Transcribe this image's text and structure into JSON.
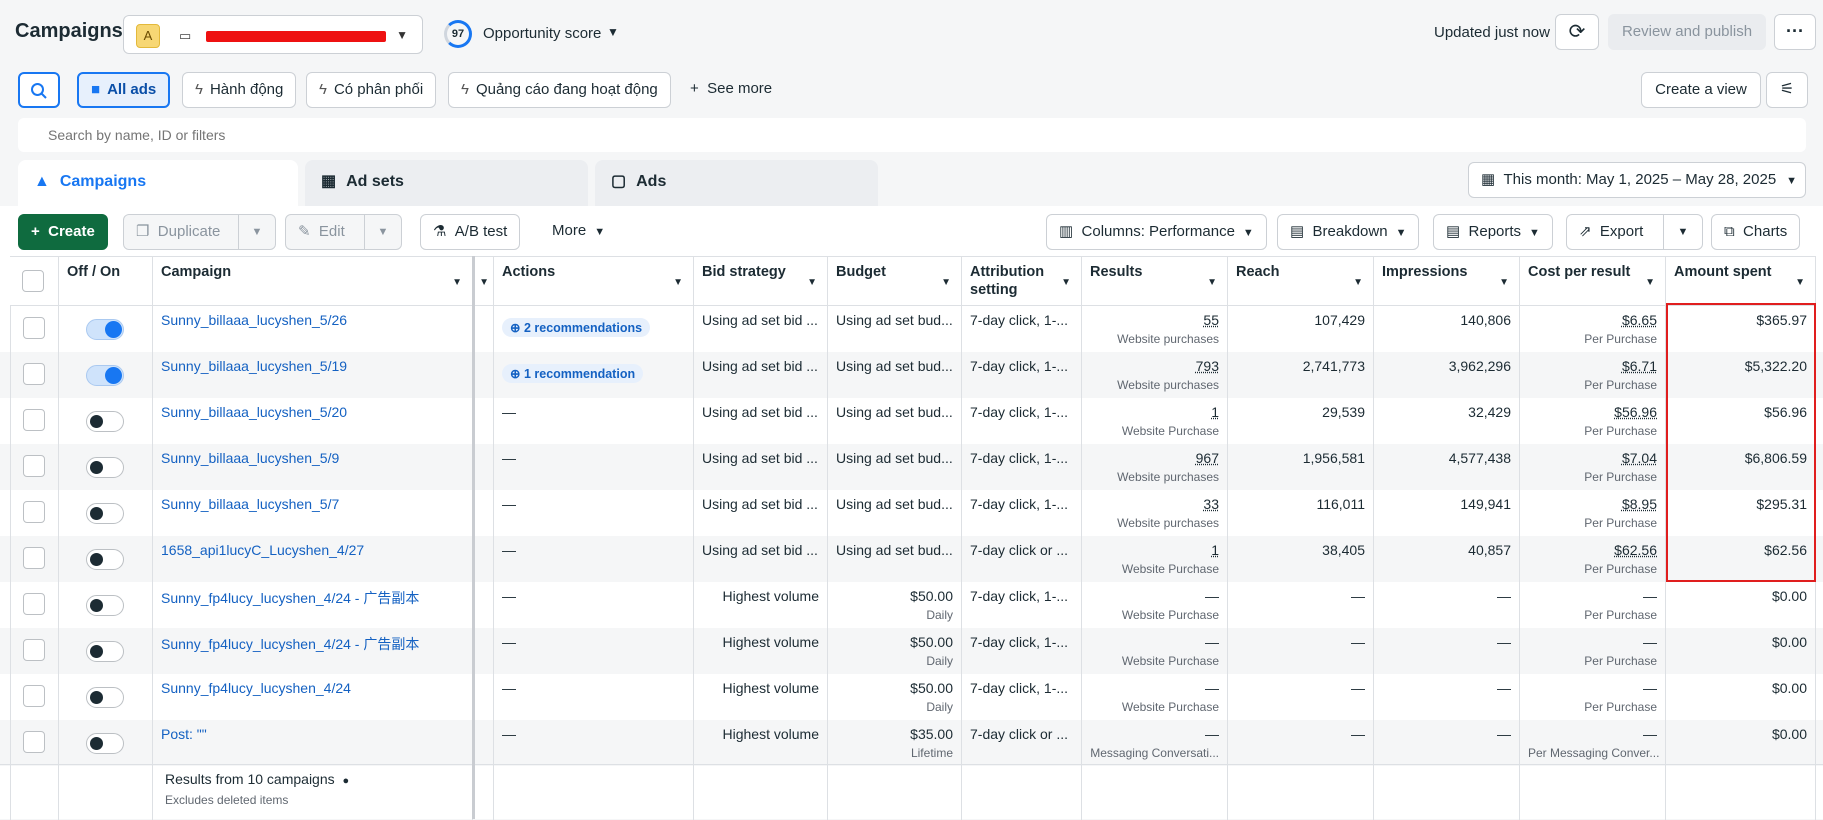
{
  "header": {
    "title": "Campaigns",
    "account_badge": "A",
    "opportunity_score": "97",
    "opportunity_label": "Opportunity score",
    "updated": "Updated just now",
    "review_publish": "Review and publish",
    "more": "···"
  },
  "filters": {
    "chips": [
      "All ads",
      "Hành động",
      "Có phân phối",
      "Quảng cáo đang hoạt động"
    ],
    "see_more": "See more",
    "create_view": "Create a view"
  },
  "search": {
    "placeholder": "Search by name, ID or filters"
  },
  "tabs": [
    "Campaigns",
    "Ad sets",
    "Ads"
  ],
  "date_range": "This month: May 1, 2025 – May 28, 2025",
  "toolbar": {
    "create": "Create",
    "duplicate": "Duplicate",
    "edit": "Edit",
    "ab_test": "A/B test",
    "more": "More",
    "columns": "Columns: Performance",
    "breakdown": "Breakdown",
    "reports": "Reports",
    "export": "Export",
    "charts": "Charts"
  },
  "columns": {
    "off_on": "Off / On",
    "campaign": "Campaign",
    "actions": "Actions",
    "bid": "Bid strategy",
    "budget": "Budget",
    "attribution": "Attribution setting",
    "results": "Results",
    "reach": "Reach",
    "impressions": "Impressions",
    "cpr": "Cost per result",
    "spent": "Amount spent"
  },
  "rows": [
    {
      "on": true,
      "campaign": "Sunny_billaaa_lucyshen_5/26",
      "actions": "2 recommendations",
      "bid": "Using ad set bid ...",
      "budget": "Using ad set bud...",
      "budget_sub": "",
      "attribution": "7-day click, 1-...",
      "results": "55",
      "results_sub": "Website purchases",
      "reach": "107,429",
      "impressions": "140,806",
      "cpr": "$6.65",
      "cpr_sub": "Per Purchase",
      "spent": "$365.97"
    },
    {
      "on": true,
      "campaign": "Sunny_billaaa_lucyshen_5/19",
      "actions": "1 recommendation",
      "bid": "Using ad set bid ...",
      "budget": "Using ad set bud...",
      "budget_sub": "",
      "attribution": "7-day click, 1-...",
      "results": "793",
      "results_sub": "Website purchases",
      "reach": "2,741,773",
      "impressions": "3,962,296",
      "cpr": "$6.71",
      "cpr_sub": "Per Purchase",
      "spent": "$5,322.20"
    },
    {
      "on": false,
      "campaign": "Sunny_billaaa_lucyshen_5/20",
      "actions": "—",
      "bid": "Using ad set bid ...",
      "budget": "Using ad set bud...",
      "budget_sub": "",
      "attribution": "7-day click, 1-...",
      "results": "1",
      "results_sub": "Website Purchase",
      "reach": "29,539",
      "impressions": "32,429",
      "cpr": "$56.96",
      "cpr_sub": "Per Purchase",
      "spent": "$56.96"
    },
    {
      "on": false,
      "campaign": "Sunny_billaaa_lucyshen_5/9",
      "actions": "—",
      "bid": "Using ad set bid ...",
      "budget": "Using ad set bud...",
      "budget_sub": "",
      "attribution": "7-day click, 1-...",
      "results": "967",
      "results_sub": "Website purchases",
      "reach": "1,956,581",
      "impressions": "4,577,438",
      "cpr": "$7.04",
      "cpr_sub": "Per Purchase",
      "spent": "$6,806.59"
    },
    {
      "on": false,
      "campaign": "Sunny_billaaa_lucyshen_5/7",
      "actions": "—",
      "bid": "Using ad set bid ...",
      "budget": "Using ad set bud...",
      "budget_sub": "",
      "attribution": "7-day click, 1-...",
      "results": "33",
      "results_sub": "Website purchases",
      "reach": "116,011",
      "impressions": "149,941",
      "cpr": "$8.95",
      "cpr_sub": "Per Purchase",
      "spent": "$295.31"
    },
    {
      "on": false,
      "campaign": "1658_api1lucyC_Lucyshen_4/27",
      "actions": "—",
      "bid": "Using ad set bid ...",
      "budget": "Using ad set bud...",
      "budget_sub": "",
      "attribution": "7-day click or ...",
      "results": "1",
      "results_sub": "Website Purchase",
      "reach": "38,405",
      "impressions": "40,857",
      "cpr": "$62.56",
      "cpr_sub": "Per Purchase",
      "spent": "$62.56"
    },
    {
      "on": false,
      "campaign": "Sunny_fp4lucy_lucyshen_4/24 - 广告副本",
      "actions": "—",
      "bid": "Highest volume",
      "budget": "$50.00",
      "budget_sub": "Daily",
      "attribution": "7-day click, 1-...",
      "results": "—",
      "results_sub": "Website Purchase",
      "reach": "—",
      "impressions": "—",
      "cpr": "—",
      "cpr_sub": "Per Purchase",
      "spent": "$0.00"
    },
    {
      "on": false,
      "campaign": "Sunny_fp4lucy_lucyshen_4/24 - 广告副本",
      "actions": "—",
      "bid": "Highest volume",
      "budget": "$50.00",
      "budget_sub": "Daily",
      "attribution": "7-day click, 1-...",
      "results": "—",
      "results_sub": "Website Purchase",
      "reach": "—",
      "impressions": "—",
      "cpr": "—",
      "cpr_sub": "Per Purchase",
      "spent": "$0.00"
    },
    {
      "on": false,
      "campaign": "Sunny_fp4lucy_lucyshen_4/24",
      "actions": "—",
      "bid": "Highest volume",
      "budget": "$50.00",
      "budget_sub": "Daily",
      "attribution": "7-day click, 1-...",
      "results": "—",
      "results_sub": "Website Purchase",
      "reach": "—",
      "impressions": "—",
      "cpr": "—",
      "cpr_sub": "Per Purchase",
      "spent": "$0.00"
    },
    {
      "on": false,
      "campaign": "Post: \"\"",
      "actions": "—",
      "bid": "Highest volume",
      "budget": "$35.00",
      "budget_sub": "Lifetime",
      "attribution": "7-day click or ...",
      "results": "—",
      "results_sub": "Messaging Conversati...",
      "reach": "—",
      "impressions": "—",
      "cpr": "—",
      "cpr_sub": "Per Messaging Conver...",
      "spent": "$0.00"
    }
  ],
  "footer": {
    "results": "Results from 10 campaigns",
    "note": "Excludes deleted items"
  },
  "colors": {
    "accent": "#1877f2",
    "create_green": "#0f6b3f",
    "highlight_red": "#e01e1e"
  }
}
